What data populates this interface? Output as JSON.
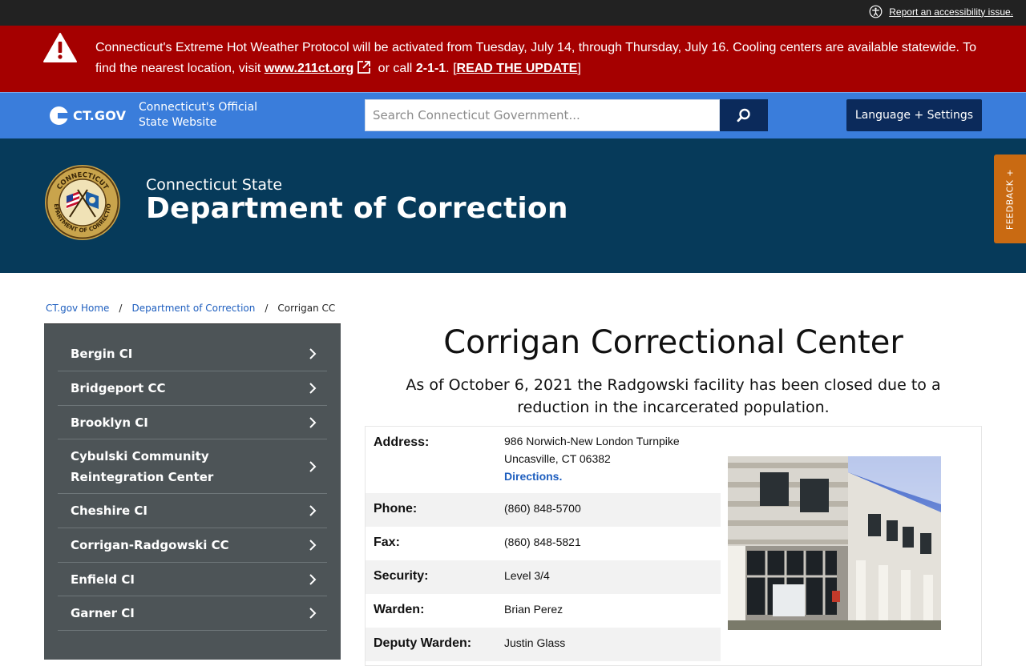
{
  "utility": {
    "accessibility_link": "Report an accessibility issue."
  },
  "alert": {
    "text_before": "Connecticut's Extreme Hot Weather Protocol will be activated from Tuesday, July 14, through Thursday, July 16. Cooling centers are available statewide. To find the nearest location, visit ",
    "link": "www.211ct.org",
    "text_mid": " or call ",
    "phone": "2-1-1",
    "text_after": ". [",
    "update_link": "READ THE UPDATE",
    "text_end": "]"
  },
  "ctgov": {
    "logo": "CT.GOV",
    "tagline": "Connecticut's Official State Website",
    "search_placeholder": "Search Connecticut Government...",
    "language_button": "Language + Settings"
  },
  "agency": {
    "subtitle": "Connecticut State",
    "title": "Department of Correction",
    "seal_top": "CONNECTICUT",
    "seal_bottom": "DEPARTMENT OF CORRECTION",
    "feedback": "FEEDBACK +"
  },
  "breadcrumb": [
    "CT.gov Home",
    "Department of Correction",
    "Corrigan CC"
  ],
  "sidebar": {
    "items": [
      "Bergin CI",
      "Bridgeport CC",
      "Brooklyn CI",
      "Cybulski Community Reintegration Center",
      "Cheshire CI",
      "Corrigan-Radgowski CC",
      "Enfield CI",
      "Garner CI"
    ]
  },
  "main": {
    "title": "Corrigan Correctional Center",
    "notice": "As of October 6, 2021 the Radgowski facility has been closed due to a reduction in the incarcerated population.",
    "address_label": "Address:",
    "address_line1": "986 Norwich-New London Turnpike",
    "address_line2": "Uncasville, CT 06382",
    "directions": "Directions.",
    "phone_label": "Phone:",
    "phone": "(860) 848-5700",
    "fax_label": "Fax:",
    "fax": "(860) 848-5821",
    "security_label": "Security:",
    "security": "Level 3/4",
    "warden_label": "Warden:",
    "warden": "Brian Perez",
    "deputy_label": "Deputy Warden:",
    "deputy": "Justin Glass"
  },
  "colors": {
    "alert_red": "#a50000",
    "ctgov_blue": "#3a7ddb",
    "navy": "#0b2a5b",
    "agency_blue": "#063a5a",
    "sidebar_gray": "#4d5457",
    "feedback_orange": "#c96a12"
  }
}
